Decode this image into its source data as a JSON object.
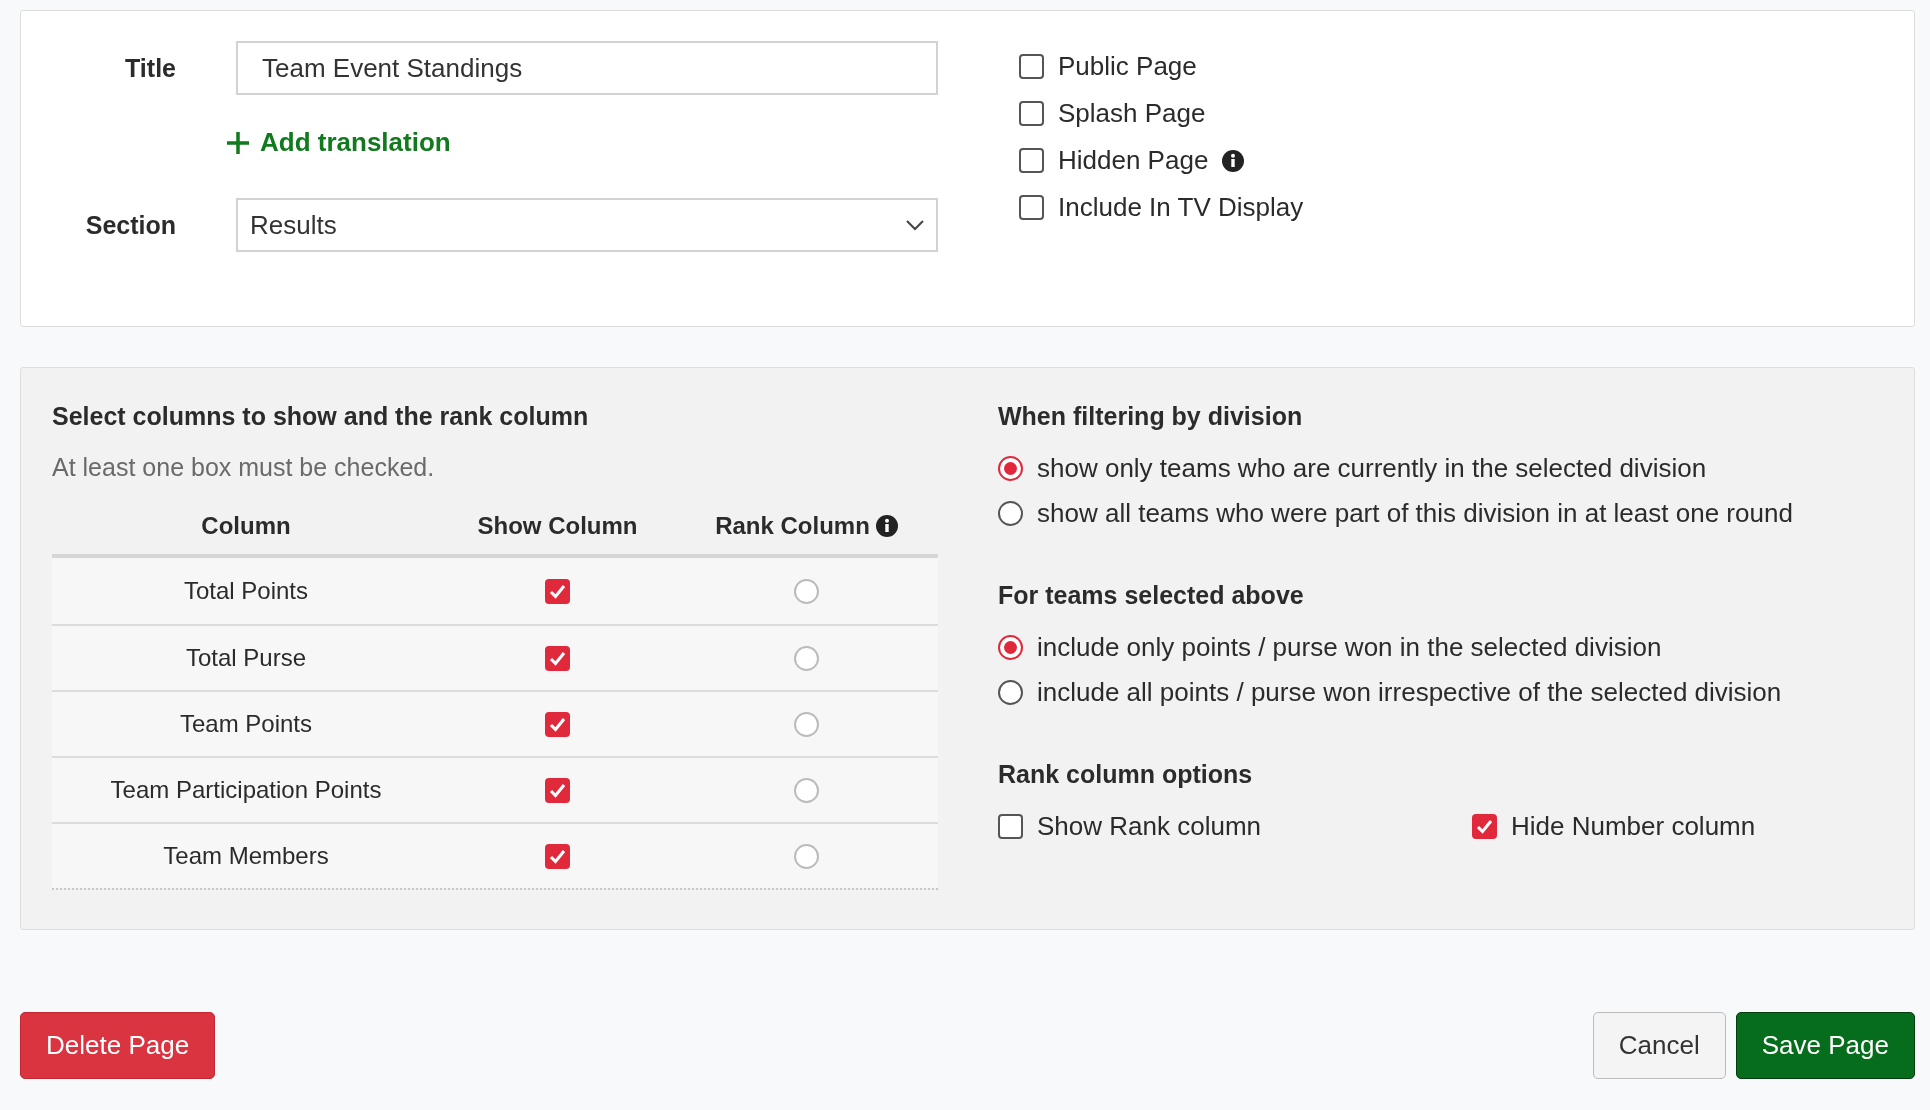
{
  "title_field": {
    "label": "Title",
    "value": "Team Event Standings"
  },
  "add_translation": {
    "label": "Add translation"
  },
  "section_field": {
    "label": "Section",
    "value": "Results"
  },
  "page_options": [
    {
      "label": "Public Page",
      "checked": false,
      "info": false
    },
    {
      "label": "Splash Page",
      "checked": false,
      "info": false
    },
    {
      "label": "Hidden Page",
      "checked": false,
      "info": true
    },
    {
      "label": "Include In TV Display",
      "checked": false,
      "info": false
    }
  ],
  "columns_panel": {
    "heading": "Select columns to show and the rank column",
    "hint": "At least one box must be checked.",
    "headers": [
      {
        "label": "Column",
        "info": false
      },
      {
        "label": "Show Column",
        "info": false
      },
      {
        "label": "Rank Column",
        "info": true
      }
    ],
    "rows": [
      {
        "name": "Total Points",
        "show": true,
        "rank": false
      },
      {
        "name": "Total Purse",
        "show": true,
        "rank": false
      },
      {
        "name": "Team Points",
        "show": true,
        "rank": false
      },
      {
        "name": "Team Participation Points",
        "show": true,
        "rank": false
      },
      {
        "name": "Team Members",
        "show": true,
        "rank": false
      }
    ]
  },
  "division_filter": {
    "heading": "When filtering by division",
    "options": [
      {
        "label": "show only teams who are currently in the selected division",
        "selected": true
      },
      {
        "label": "show all teams who were part of this division in at least one round",
        "selected": false
      }
    ]
  },
  "teams_scope": {
    "heading": "For teams selected above",
    "options": [
      {
        "label": "include only points / purse won in the selected division",
        "selected": true
      },
      {
        "label": "include all points / purse won irrespective of the selected division",
        "selected": false
      }
    ]
  },
  "rank_options": {
    "heading": "Rank column options",
    "options": [
      {
        "label": "Show Rank column",
        "checked": false
      },
      {
        "label": "Hide Number column",
        "checked": true
      }
    ]
  },
  "buttons": [
    {
      "label": "Delete Page",
      "kind": "danger"
    },
    {
      "label": "Cancel",
      "kind": "secondary"
    },
    {
      "label": "Save Page",
      "kind": "primary"
    }
  ]
}
